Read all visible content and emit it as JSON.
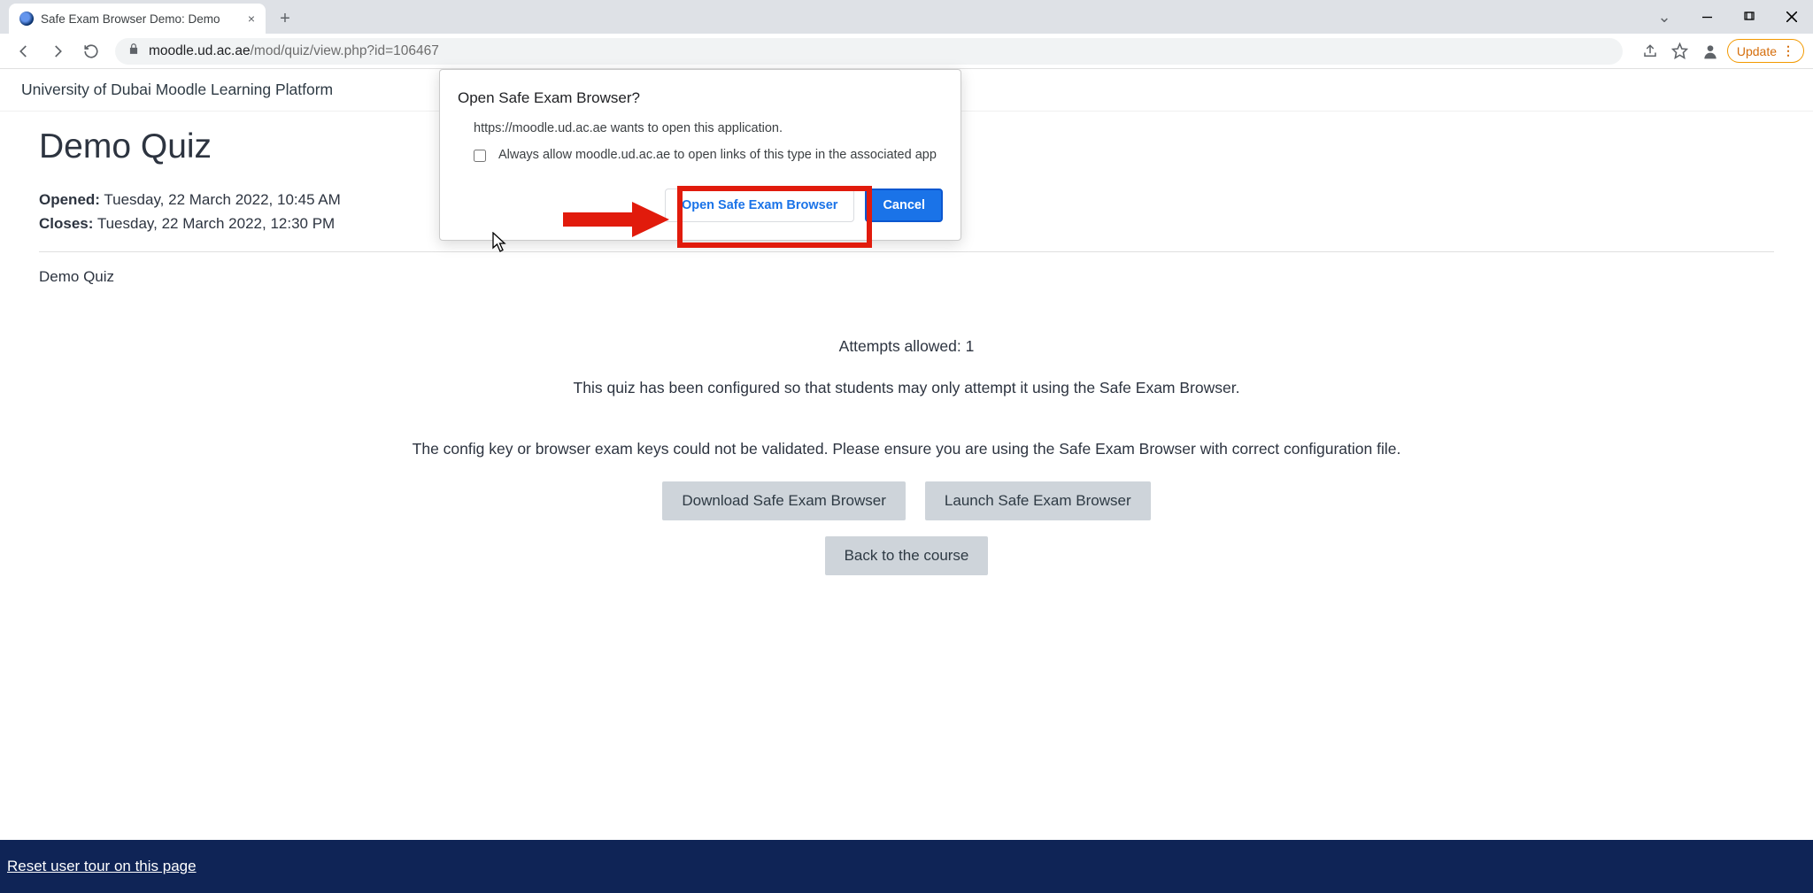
{
  "browser": {
    "tab_title": "Safe Exam Browser Demo: Demo",
    "url_domain": "moodle.ud.ac.ae",
    "url_path": "/mod/quiz/view.php?id=106467",
    "update_label": "Update"
  },
  "siteHeader": {
    "title": "University of Dubai Moodle Learning Platform"
  },
  "quiz": {
    "title": "Demo Quiz",
    "opened_label": "Opened:",
    "opened_value": "Tuesday, 22 March 2022, 10:45 AM",
    "closes_label": "Closes:",
    "closes_value": "Tuesday, 22 March 2022, 12:30 PM",
    "description": "Demo Quiz",
    "attempts_text": "Attempts allowed: 1",
    "seb_text": "This quiz has been configured so that students may only attempt it using the Safe Exam Browser.",
    "error_text": "The config key or browser exam keys could not be validated. Please ensure you are using the Safe Exam Browser with correct configuration file.",
    "download_btn": "Download Safe Exam Browser",
    "launch_btn": "Launch Safe Exam Browser",
    "back_btn": "Back to the course"
  },
  "footer": {
    "reset_link": "Reset user tour on this page"
  },
  "dialog": {
    "title": "Open Safe Exam Browser?",
    "body": "https://moodle.ud.ac.ae wants to open this application.",
    "checkbox_label": "Always allow moodle.ud.ac.ae to open links of this type in the associated app",
    "open_btn": "Open Safe Exam Browser",
    "cancel_btn": "Cancel"
  }
}
